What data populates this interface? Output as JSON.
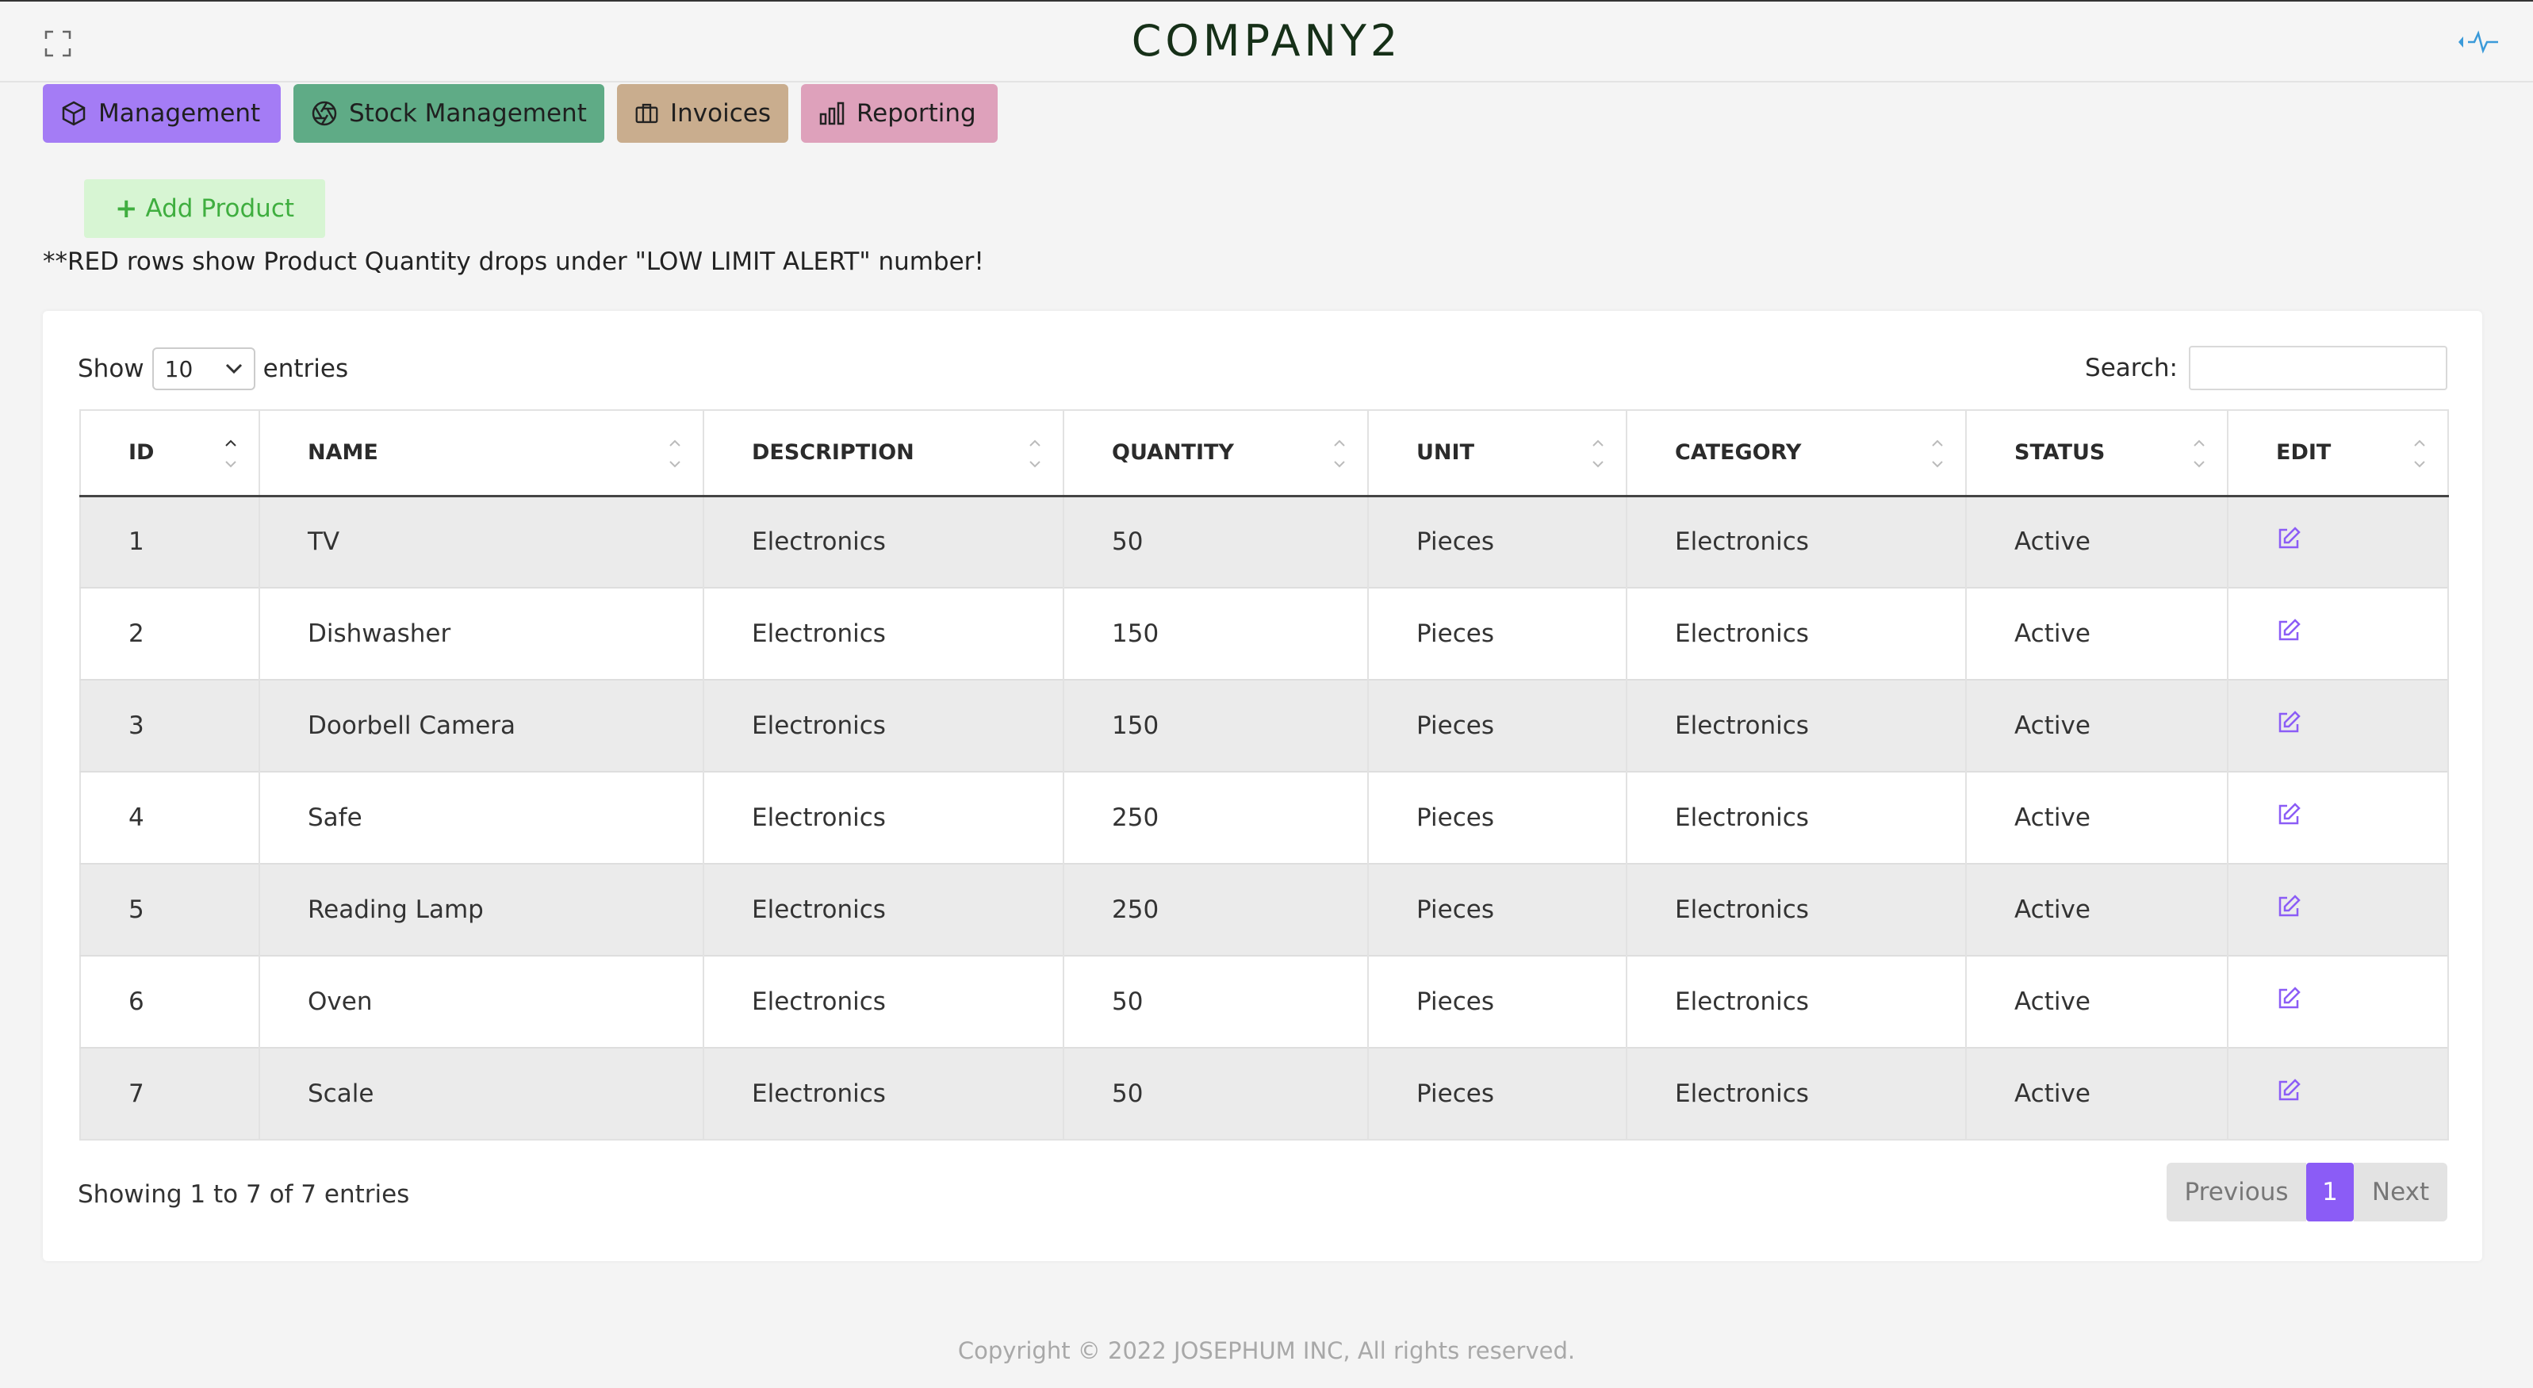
{
  "header": {
    "brand": "COMPANY2",
    "expand_icon": "expand-icon",
    "activity_icon": "activity-icon"
  },
  "nav": [
    {
      "label": "Management",
      "icon": "cube-icon",
      "color": "#a47cf5"
    },
    {
      "label": "Stock Management",
      "icon": "aperture-icon",
      "color": "#5fab86"
    },
    {
      "label": "Invoices",
      "icon": "briefcase-icon",
      "color": "#c9ad8e"
    },
    {
      "label": "Reporting",
      "icon": "bar-chart-icon",
      "color": "#dea1bb"
    }
  ],
  "add_button": {
    "label": "Add Product",
    "icon": "plus-icon"
  },
  "notice": "**RED rows show Product Quantity drops under \"LOW LIMIT ALERT\" number!",
  "table": {
    "show_label": "Show",
    "length_value": "10",
    "entries_label": "entries",
    "search_label": "Search:",
    "search_value": "",
    "columns": [
      "ID",
      "NAME",
      "DESCRIPTION",
      "QUANTITY",
      "UNIT",
      "CATEGORY",
      "STATUS",
      "EDIT"
    ],
    "rows": [
      {
        "id": "1",
        "name": "TV",
        "description": "Electronics",
        "quantity": "50",
        "unit": "Pieces",
        "category": "Electronics",
        "status": "Active"
      },
      {
        "id": "2",
        "name": "Dishwasher",
        "description": "Electronics",
        "quantity": "150",
        "unit": "Pieces",
        "category": "Electronics",
        "status": "Active"
      },
      {
        "id": "3",
        "name": "Doorbell Camera",
        "description": "Electronics",
        "quantity": "150",
        "unit": "Pieces",
        "category": "Electronics",
        "status": "Active"
      },
      {
        "id": "4",
        "name": "Safe",
        "description": "Electronics",
        "quantity": "250",
        "unit": "Pieces",
        "category": "Electronics",
        "status": "Active"
      },
      {
        "id": "5",
        "name": "Reading Lamp",
        "description": "Electronics",
        "quantity": "250",
        "unit": "Pieces",
        "category": "Electronics",
        "status": "Active"
      },
      {
        "id": "6",
        "name": "Oven",
        "description": "Electronics",
        "quantity": "50",
        "unit": "Pieces",
        "category": "Electronics",
        "status": "Active"
      },
      {
        "id": "7",
        "name": "Scale",
        "description": "Electronics",
        "quantity": "50",
        "unit": "Pieces",
        "category": "Electronics",
        "status": "Active"
      }
    ],
    "info": "Showing 1 to 7 of 7 entries",
    "pagination": {
      "previous": "Previous",
      "current": "1",
      "next": "Next"
    }
  },
  "footer": "Copyright © 2022  JOSEPHUM INC, All rights reserved.",
  "colors": {
    "accent": "#8b5cf6",
    "add_button_text": "#3fae3f",
    "add_button_bg": "#d7f5d3",
    "edit_icon": "#8b5cf6"
  }
}
